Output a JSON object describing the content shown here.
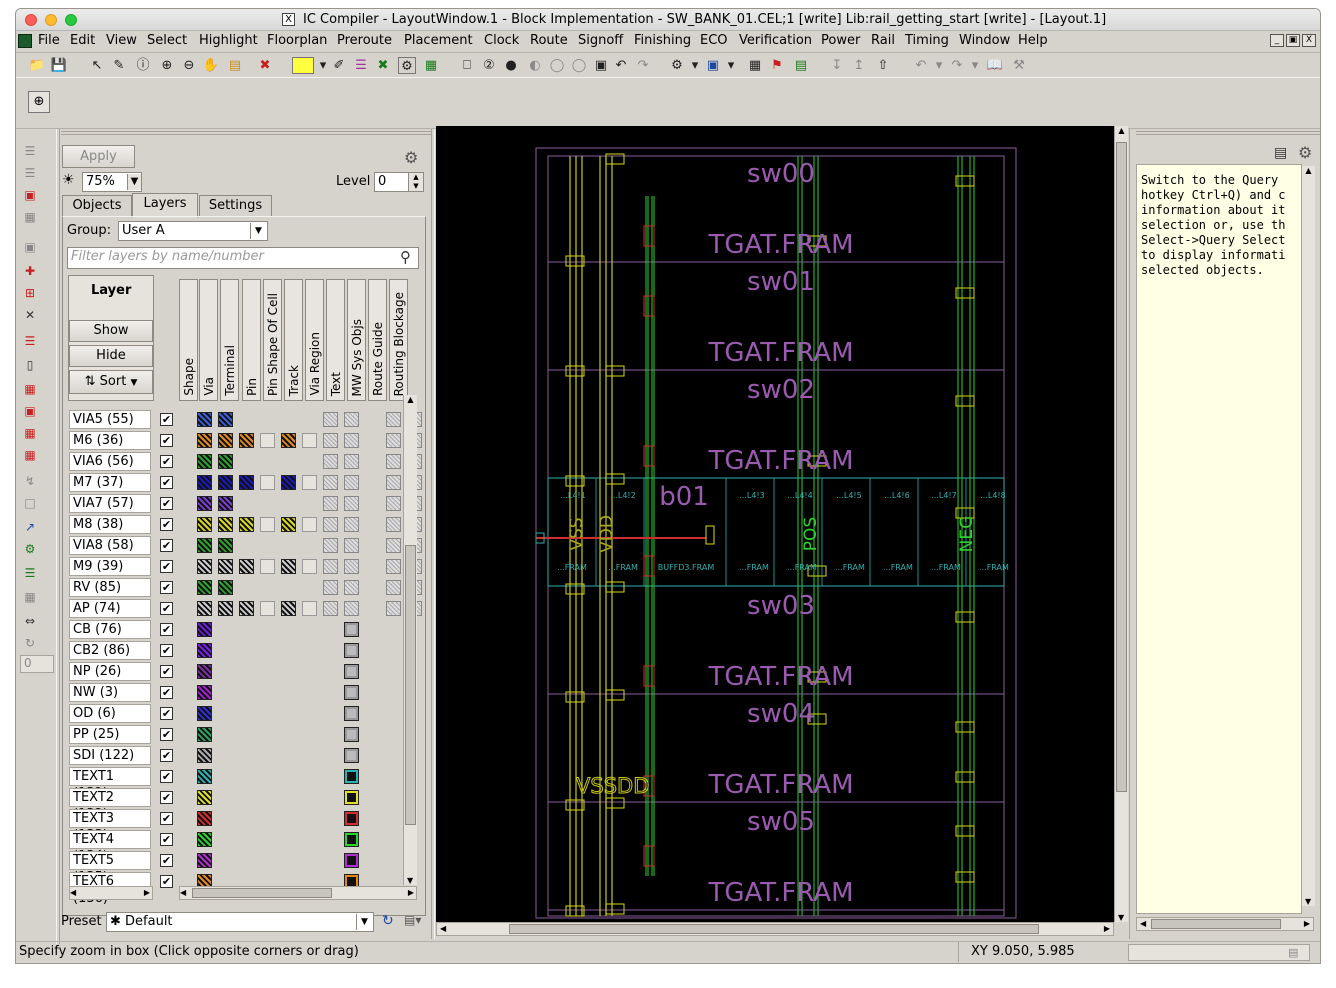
{
  "window": {
    "title": "IC Compiler - LayoutWindow.1 - Block Implementation - SW_BANK_01.CEL;1 [write]   Lib:rail_getting_start [write] - [Layout.1]"
  },
  "menu": [
    "File",
    "Edit",
    "View",
    "Select",
    "Highlight",
    "Floorplan",
    "Preroute",
    "Placement",
    "Clock",
    "Route",
    "Signoff",
    "Finishing",
    "ECO",
    "Verification",
    "Power",
    "Rail",
    "Timing",
    "Window",
    "Help"
  ],
  "panel": {
    "apply_label": "Apply",
    "zoom_value": "75%",
    "level_label": "Level",
    "level_value": "0",
    "tabs": [
      "Objects",
      "Layers",
      "Settings"
    ],
    "group_label": "Group:",
    "group_value": "User A",
    "filter_placeholder": "Filter layers by name/number",
    "layer_header": "Layer",
    "show_label": "Show",
    "hide_label": "Hide",
    "sort_label": "Sort",
    "columns": [
      "Shape",
      "Via",
      "Terminal",
      "Pin",
      "Pin Shape Of Cell",
      "Track",
      "Via Region",
      "Text",
      "MW Sys Objs",
      "Route Guide",
      "Routing Blockage"
    ],
    "layers": [
      {
        "name": "VIA5 (55)",
        "color": "#3a5fd8"
      },
      {
        "name": "M6 (36)",
        "color": "#e08a1e"
      },
      {
        "name": "VIA6 (56)",
        "color": "#2fa02f"
      },
      {
        "name": "M7 (37)",
        "color": "#1a1ab8"
      },
      {
        "name": "VIA7 (57)",
        "color": "#7a3fd0"
      },
      {
        "name": "M8 (38)",
        "color": "#d8d81a"
      },
      {
        "name": "VIA8 (58)",
        "color": "#2fa02f"
      },
      {
        "name": "M9 (39)",
        "color": "#cccccc"
      },
      {
        "name": "RV (85)",
        "color": "#2fa02f"
      },
      {
        "name": "AP (74)",
        "color": "#cccccc"
      },
      {
        "name": "CB (76)",
        "color": "#6a1fd8"
      },
      {
        "name": "CB2 (86)",
        "color": "#7a1ff0"
      },
      {
        "name": "NP (26)",
        "color": "#7a2fa0"
      },
      {
        "name": "NW (3)",
        "color": "#a01fd0"
      },
      {
        "name": "OD (6)",
        "color": "#2f2fd0"
      },
      {
        "name": "PP (25)",
        "color": "#2fa05f"
      },
      {
        "name": "SDI (122)",
        "color": "#aaaaaa"
      },
      {
        "name": "TEXT1 (131)",
        "color": "#2fb0b0"
      },
      {
        "name": "TEXT2 (132)",
        "color": "#e0e02f"
      },
      {
        "name": "TEXT3 (133)",
        "color": "#d02f2f"
      },
      {
        "name": "TEXT4 (134)",
        "color": "#2fd02f"
      },
      {
        "name": "TEXT5 (135)",
        "color": "#b02fd0"
      },
      {
        "name": "TEXT6 (136)",
        "color": "#e08a1e"
      }
    ],
    "preset_label": "Preset",
    "preset_value": "✱ Default"
  },
  "layout": {
    "rows": [
      "sw00",
      "sw01",
      "sw02",
      "sw03",
      "sw04",
      "sw05"
    ],
    "cell_label": "TGAT.FRAM",
    "b01": "b01",
    "top_labels": [
      "...L4!1",
      "...L4!2",
      "...L4!3",
      "...L4!4",
      "...L4!5",
      "...L4!6",
      "...L4!7",
      "...L4!8"
    ],
    "bottom_labels": [
      "...FRAM",
      "...FRAM",
      "BUFFD3.FRAM",
      "...FRAM",
      "...FRAM",
      "...FRAM",
      "...FRAM",
      "...FRAM",
      "...FRAM"
    ],
    "vss": "VSS",
    "vdd": "VDD",
    "pos": "POS",
    "neg": "NEG",
    "vss_vdd_label": "VSSDD"
  },
  "help_text": "Switch to the Query\nhotkey Ctrl+Q) and c\ninformation about it\nselection or, use th\nSelect->Query Select\nto display informati\nselected objects.",
  "status": {
    "message": "Specify zoom in box (Click opposite corners or drag)",
    "coords": "XY 9.050, 5.985"
  }
}
